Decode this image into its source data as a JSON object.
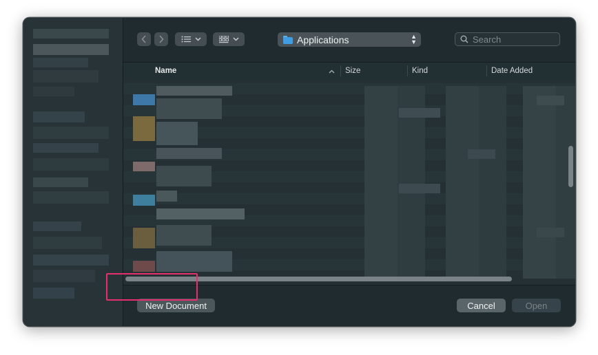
{
  "toolbar": {
    "path_popup_label": "Applications",
    "search_placeholder": "Search",
    "list_view_icon": "list-icon",
    "gallery_view_icon": "grid-icon"
  },
  "columns": [
    {
      "label": "Name",
      "sort": "ascending"
    },
    {
      "label": "Size"
    },
    {
      "label": "Kind"
    },
    {
      "label": "Date Added"
    }
  ],
  "buttons": {
    "new_document": "New Document",
    "cancel": "Cancel",
    "open": "Open"
  },
  "colors": {
    "accent_highlight": "#e6306c",
    "folder_icon": "#3e9de3"
  }
}
